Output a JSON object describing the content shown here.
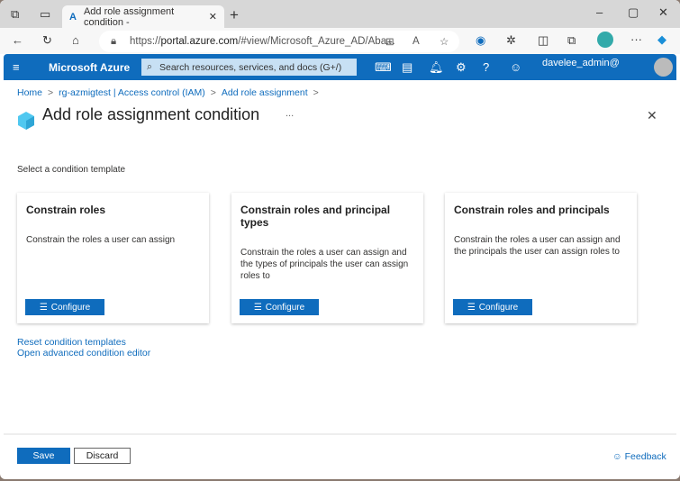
{
  "browser": {
    "tab_title": "Add role assignment condition -",
    "url_prefix": "https://",
    "url_domain": "portal.azure.com",
    "url_rest": "/#view/Microsoft_Azure_AD/Aba..."
  },
  "portal": {
    "brand": "Microsoft Azure",
    "search_placeholder": "Search resources, services, and docs (G+/)",
    "user": "davelee_admin@"
  },
  "breadcrumb": [
    "Home",
    "rg-azmigtest | Access control (IAM)",
    "Add role assignment"
  ],
  "page": {
    "title": "Add role assignment condition",
    "more": "...",
    "section_label": "Select a condition template"
  },
  "cards": [
    {
      "title": "Constrain roles",
      "description": "Constrain the roles a user can assign",
      "button": "Configure"
    },
    {
      "title": "Constrain roles and principal types",
      "description": "Constrain the roles a user can assign and the types of principals the user can assign roles to",
      "button": "Configure"
    },
    {
      "title": "Constrain roles and principals",
      "description": "Constrain the roles a user can assign and the principals the user can assign roles to",
      "button": "Configure"
    }
  ],
  "links": {
    "reset": "Reset condition templates",
    "advanced": "Open advanced condition editor"
  },
  "footer": {
    "save": "Save",
    "discard": "Discard",
    "feedback": "Feedback"
  },
  "colors": {
    "accent": "#0f6cbd"
  }
}
